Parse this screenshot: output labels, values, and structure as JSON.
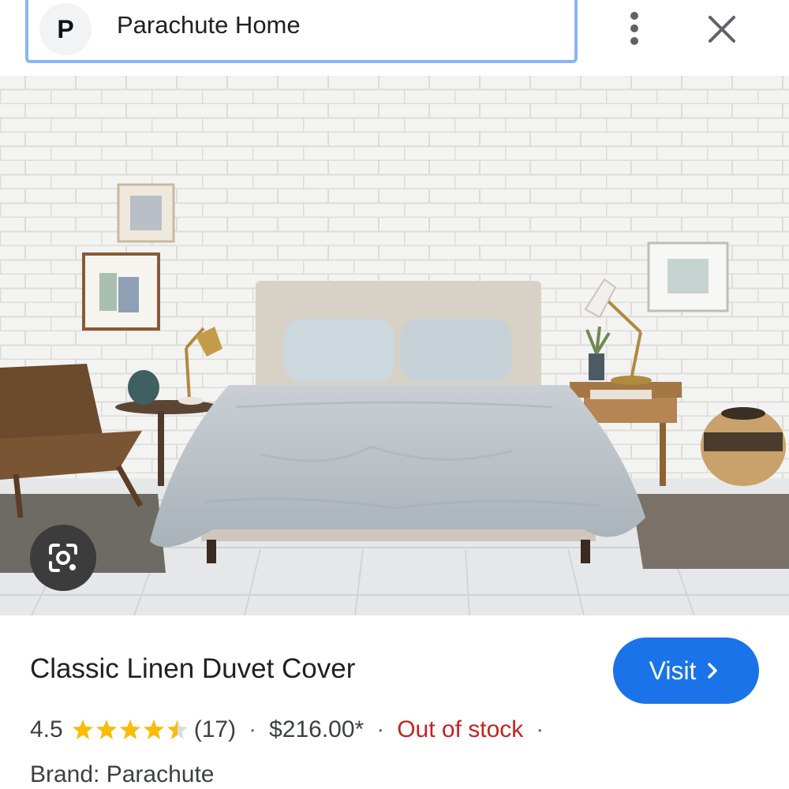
{
  "header": {
    "logo_letter": "P",
    "source_name": "Parachute Home"
  },
  "icons": {
    "more": "more-vert-icon",
    "close": "close-icon",
    "lens": "google-lens-icon",
    "visit_chevron": "chevron-right-icon"
  },
  "product": {
    "title": "Classic Linen Duvet Cover",
    "visit_label": "Visit",
    "rating": "4.5",
    "rating_value": 4.5,
    "rating_max": 5,
    "review_count": "(17)",
    "separator": "·",
    "price": "$216.00*",
    "stock_status": "Out of stock",
    "brand_label": "Brand: ",
    "brand_value": "Parachute"
  },
  "colors": {
    "accent": "#1a73e8",
    "star": "#fbbc04",
    "out_of_stock": "#c5221f",
    "focus_border": "#8ab4f8"
  }
}
